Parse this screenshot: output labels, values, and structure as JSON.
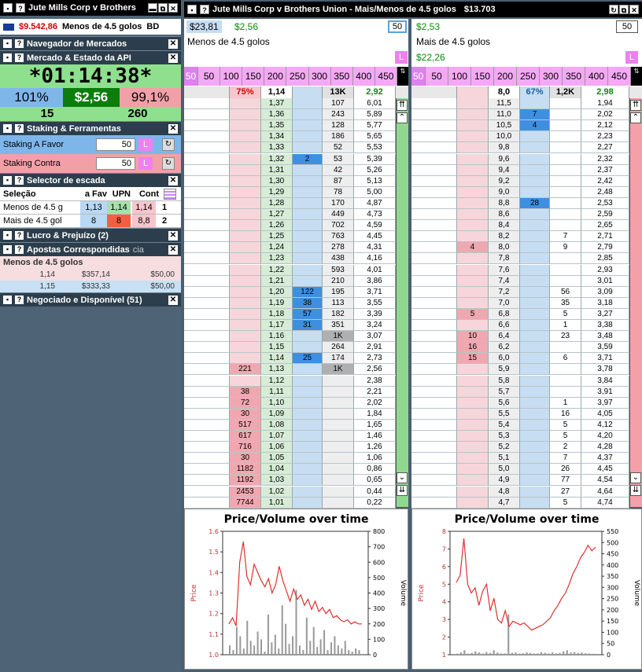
{
  "left_header": {
    "title": "Jute Mills Corp v Brothers"
  },
  "account": {
    "balance": "$9.542,86",
    "market": "Menos de 4.5 golos",
    "code": "BD"
  },
  "sections": {
    "nav": "Navegador de Mercados",
    "api": "Mercado & Estado da API",
    "staking": "Staking & Ferramentas",
    "ladder_sel": "Selector de escada",
    "pl": "Lucro & Prejuízo (2)",
    "matched": "Apostas Correspondidas",
    "matched_tail": "cia",
    "traded": "Negociado e Disponível (51)"
  },
  "timer": "*01:14:38*",
  "api_stats": {
    "back_pct": "101%",
    "price": "$2,56",
    "lay_pct": "99,1%",
    "left_num": "15",
    "right_num": "260"
  },
  "staking": {
    "favor_label": "Staking A Favor",
    "favor_value": "50",
    "contra_label": "Staking Contra",
    "contra_value": "50",
    "l_button": "L"
  },
  "selector": {
    "headers": [
      "Seleção",
      "a Fav",
      "UPN",
      "Cont"
    ],
    "rows": [
      {
        "name": "Menos de 4.5 g",
        "fav": "1,13",
        "upn": "1,14",
        "cont": "1,14",
        "idx": "1"
      },
      {
        "name": "Mais de 4.5 gol",
        "fav": "8",
        "upn": "8",
        "cont": "8,8",
        "idx": "2"
      }
    ]
  },
  "matched": {
    "title": "Menos de 4.5 golos",
    "rows": [
      {
        "odds": "1,14",
        "profit": "$357,14",
        "stake": "$50,00"
      },
      {
        "odds": "1,15",
        "profit": "$333,33",
        "stake": "$50,00"
      }
    ]
  },
  "right_header": {
    "title": "Jute Mills Corp v Brothers Union - Mais/Menos de 4.5 golos",
    "amount": "$13.703"
  },
  "stake_buttons": [
    "50",
    "100",
    "150",
    "200",
    "250",
    "300",
    "350",
    "400",
    "450"
  ],
  "ladder1": {
    "ltp_value": "$23,81",
    "price": "$2,56",
    "runner": "Menos de 4.5 golos",
    "stake": "50",
    "top": {
      "pct": "75%",
      "ltp": "1,14",
      "vol": "13K",
      "value": "2,92"
    },
    "rows": [
      [
        "",
        "1,37",
        "",
        "107",
        "6,01"
      ],
      [
        "",
        "1,36",
        "",
        "243",
        "5,89"
      ],
      [
        "",
        "1,35",
        "",
        "128",
        "5,77"
      ],
      [
        "",
        "1,34",
        "",
        "186",
        "5,65"
      ],
      [
        "",
        "1,33",
        "",
        "52",
        "5,53"
      ],
      [
        "",
        "1,32",
        "2",
        "53",
        "5,39"
      ],
      [
        "",
        "1,31",
        "",
        "42",
        "5,26"
      ],
      [
        "",
        "1,30",
        "",
        "87",
        "5,13"
      ],
      [
        "",
        "1,29",
        "",
        "78",
        "5,00"
      ],
      [
        "",
        "1,28",
        "",
        "170",
        "4,87"
      ],
      [
        "",
        "1,27",
        "",
        "449",
        "4,73"
      ],
      [
        "",
        "1,26",
        "",
        "702",
        "4,59"
      ],
      [
        "",
        "1,25",
        "",
        "763",
        "4,45"
      ],
      [
        "",
        "1,24",
        "",
        "278",
        "4,31"
      ],
      [
        "",
        "1,23",
        "",
        "438",
        "4,16"
      ],
      [
        "",
        "1,22",
        "",
        "593",
        "4,01"
      ],
      [
        "",
        "1,21",
        "",
        "210",
        "3,86"
      ],
      [
        "",
        "1,20",
        "122",
        "195",
        "3,71"
      ],
      [
        "",
        "1,19",
        "38",
        "113",
        "3,55"
      ],
      [
        "",
        "1,18",
        "57",
        "182",
        "3,39"
      ],
      [
        "",
        "1,17",
        "31",
        "351",
        "3,24"
      ],
      [
        "",
        "1,16",
        "",
        "1K",
        "3,07"
      ],
      [
        "",
        "1,15",
        "",
        "264",
        "2,91"
      ],
      [
        "",
        "1,14",
        "25",
        "174",
        "2,73"
      ],
      [
        "221",
        "1,13",
        "",
        "1K",
        "2,56"
      ],
      [
        "",
        "1,12",
        "",
        "",
        "2,38"
      ],
      [
        "38",
        "1,11",
        "",
        "",
        "2,21"
      ],
      [
        "72",
        "1,10",
        "",
        "",
        "2,02"
      ],
      [
        "30",
        "1,09",
        "",
        "",
        "1,84"
      ],
      [
        "517",
        "1,08",
        "",
        "",
        "1,65"
      ],
      [
        "617",
        "1,07",
        "",
        "",
        "1,46"
      ],
      [
        "716",
        "1,06",
        "",
        "",
        "1,26"
      ],
      [
        "30",
        "1,05",
        "",
        "",
        "1,06"
      ],
      [
        "1182",
        "1,04",
        "",
        "",
        "0,86"
      ],
      [
        "1192",
        "1,03",
        "",
        "",
        "0,65"
      ],
      [
        "2453",
        "1,02",
        "",
        "",
        "0,44"
      ],
      [
        "7744",
        "1,01",
        "",
        "",
        "0,22"
      ]
    ]
  },
  "ladder2": {
    "ltp_value": "$2,53",
    "runner": "Mais de 4.5 golos",
    "pl": "$22,26",
    "stake": "50",
    "top": {
      "ltp": "8,0",
      "pct": "67%",
      "vol": "1,2K",
      "value": "2,98"
    },
    "rows": [
      [
        "",
        "11,5",
        "",
        "",
        "1,94"
      ],
      [
        "",
        "11,0",
        "7",
        "",
        "2,02"
      ],
      [
        "",
        "10,5",
        "4",
        "",
        "2,12"
      ],
      [
        "",
        "10,0",
        "",
        "",
        "2,23"
      ],
      [
        "",
        "9,8",
        "",
        "",
        "2,27"
      ],
      [
        "",
        "9,6",
        "",
        "",
        "2,32"
      ],
      [
        "",
        "9,4",
        "",
        "",
        "2,37"
      ],
      [
        "",
        "9,2",
        "",
        "",
        "2,42"
      ],
      [
        "",
        "9,0",
        "",
        "",
        "2,48"
      ],
      [
        "",
        "8,8",
        "28",
        "",
        "2,53"
      ],
      [
        "",
        "8,6",
        "",
        "",
        "2,59"
      ],
      [
        "",
        "8,4",
        "",
        "",
        "2,65"
      ],
      [
        "",
        "8,2",
        "",
        "7",
        "2,71"
      ],
      [
        "4",
        "8,0",
        "",
        "9",
        "2,79"
      ],
      [
        "",
        "7,8",
        "",
        "",
        "2,85"
      ],
      [
        "",
        "7,6",
        "",
        "",
        "2,93"
      ],
      [
        "",
        "7,4",
        "",
        "",
        "3,01"
      ],
      [
        "",
        "7,2",
        "",
        "56",
        "3,09"
      ],
      [
        "",
        "7,0",
        "",
        "35",
        "3,18"
      ],
      [
        "5",
        "6,8",
        "",
        "5",
        "3,27"
      ],
      [
        "",
        "6,6",
        "",
        "1",
        "3,38"
      ],
      [
        "10",
        "6,4",
        "",
        "23",
        "3,48"
      ],
      [
        "16",
        "6,2",
        "",
        "",
        "3,59"
      ],
      [
        "15",
        "6,0",
        "",
        "6",
        "3,71"
      ],
      [
        "",
        "5,9",
        "",
        "",
        "3,78"
      ],
      [
        "",
        "5,8",
        "",
        "",
        "3,84"
      ],
      [
        "",
        "5,7",
        "",
        "",
        "3,91"
      ],
      [
        "",
        "5,6",
        "",
        "1",
        "3,97"
      ],
      [
        "",
        "5,5",
        "",
        "16",
        "4,05"
      ],
      [
        "",
        "5,4",
        "",
        "5",
        "4,12"
      ],
      [
        "",
        "5,3",
        "",
        "5",
        "4,20"
      ],
      [
        "",
        "5,2",
        "",
        "2",
        "4,28"
      ],
      [
        "",
        "5,1",
        "",
        "7",
        "4,37"
      ],
      [
        "",
        "5,0",
        "",
        "26",
        "4,45"
      ],
      [
        "",
        "4,9",
        "",
        "77",
        "4,54"
      ],
      [
        "",
        "4,8",
        "",
        "27",
        "4,64"
      ],
      [
        "",
        "4,7",
        "",
        "5",
        "4,74"
      ]
    ]
  },
  "chart_data": [
    {
      "type": "line",
      "title": "Price/Volume over time",
      "ylabel": "Price",
      "y2label": "Volume",
      "ylim": [
        1.0,
        1.6
      ],
      "y2lim": [
        0,
        800
      ],
      "yticks": [
        "1.0",
        "1.1",
        "1.2",
        "1.3",
        "1.4",
        "1.5",
        "1.6"
      ],
      "y2ticks": [
        "0",
        "100",
        "200",
        "300",
        "400",
        "500",
        "600",
        "700",
        "800"
      ],
      "price": [
        1.15,
        1.18,
        1.14,
        1.45,
        1.55,
        1.38,
        1.34,
        1.44,
        1.4,
        1.36,
        1.33,
        1.37,
        1.3,
        1.34,
        1.43,
        1.36,
        1.31,
        1.26,
        1.32,
        1.27,
        1.29,
        1.24,
        1.27,
        1.22,
        1.26,
        1.21,
        1.23,
        1.2,
        1.22,
        1.18,
        1.19,
        1.17,
        1.16,
        1.17,
        1.15,
        1.16,
        1.15,
        1.15
      ],
      "volume": [
        60,
        30,
        180,
        120,
        40,
        220,
        90,
        60,
        150,
        100,
        20,
        260,
        80,
        130,
        40,
        320,
        200,
        70,
        120,
        420,
        60,
        30,
        240,
        90,
        180,
        50,
        100,
        160,
        30,
        80,
        120,
        60,
        40,
        90,
        30,
        20,
        40,
        30
      ]
    },
    {
      "type": "line",
      "title": "Price/Volume over time",
      "ylabel": "Price",
      "y2label": "Volume",
      "ylim": [
        1,
        8
      ],
      "y2lim": [
        0,
        550
      ],
      "yticks": [
        "1",
        "2",
        "3",
        "4",
        "5",
        "6",
        "7",
        "8"
      ],
      "y2ticks": [
        "0",
        "50",
        "100",
        "150",
        "200",
        "250",
        "300",
        "350",
        "400",
        "450",
        "500",
        "550"
      ],
      "price": [
        5.1,
        5.5,
        7.6,
        5.0,
        4.5,
        4.8,
        3.8,
        4.6,
        5.0,
        3.5,
        4.2,
        3.0,
        2.8,
        3.5,
        2.6,
        2.9,
        2.8,
        2.7,
        2.8,
        2.6,
        2.4,
        2.5,
        2.6,
        2.7,
        2.9,
        3.1,
        3.5,
        3.8,
        4.2,
        4.5,
        5.0,
        5.6,
        6.0,
        6.5,
        6.8,
        7.2,
        6.9,
        7.1
      ],
      "volume": [
        5,
        10,
        20,
        5,
        8,
        15,
        10,
        5,
        12,
        8,
        20,
        10,
        5,
        6,
        180,
        8,
        10,
        5,
        6,
        10,
        8,
        5,
        6,
        12,
        8,
        5,
        10,
        6,
        8,
        15,
        20,
        10,
        12,
        8,
        10,
        6,
        5,
        4
      ]
    }
  ]
}
